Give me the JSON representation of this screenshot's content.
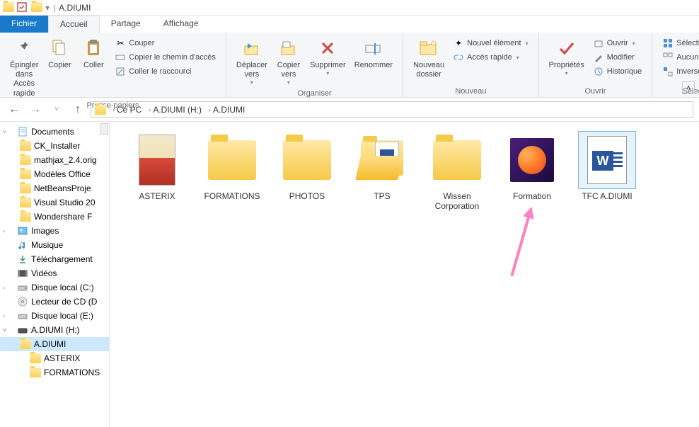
{
  "window": {
    "title": "A.DIUMI",
    "title_sep": "|"
  },
  "tabs": {
    "file": "Fichier",
    "home": "Accueil",
    "share": "Partage",
    "view": "Affichage"
  },
  "ribbon": {
    "clipboard": {
      "pin": "Épingler dans\nAccès rapide",
      "copy": "Copier",
      "paste": "Coller",
      "cut": "Couper",
      "copypath": "Copier le chemin d'accès",
      "shortcut": "Coller le raccourci",
      "label": "Presse-papiers"
    },
    "organize": {
      "moveto": "Déplacer\nvers",
      "copyto": "Copier\nvers",
      "delete": "Supprimer",
      "rename": "Renommer",
      "label": "Organiser"
    },
    "new": {
      "newfolder": "Nouveau\ndossier",
      "newitem": "Nouvel élément",
      "quickaccess": "Accès rapide",
      "label": "Nouveau"
    },
    "open": {
      "properties": "Propriétés",
      "open": "Ouvrir",
      "edit": "Modifier",
      "history": "Historique",
      "label": "Ouvrir"
    },
    "select": {
      "all": "Sélectionner tout",
      "none": "Aucun",
      "invert": "Inverser la sélection",
      "label": "Sélectionner"
    }
  },
  "breadcrumb": {
    "root": "Ce PC",
    "drive": "A.DIUMI (H:)",
    "folder": "A.DIUMI"
  },
  "tree": {
    "documents": "Documents",
    "ck": "CK_Installer",
    "mathjax": "mathjax_2.4.orig",
    "modeles": "Modèles Office",
    "netbeans": "NetBeansProje",
    "vs": "Visual Studio 20",
    "wonder": "Wondershare F",
    "images": "Images",
    "music": "Musique",
    "downloads": "Téléchargement",
    "videos": "Vidéos",
    "diskc": "Disque local (C:)",
    "cd": "Lecteur de CD (D",
    "diske": "Disque local (E:)",
    "driveh": "A.DIUMI (H:)",
    "adiumi": "A.DIUMI",
    "asterix": "ASTERIX",
    "formations": "FORMATIONS"
  },
  "items": {
    "asterix": "ASTERIX",
    "formations": "FORMATIONS",
    "photos": "PHOTOS",
    "tps": "TPS",
    "wissen": "Wissen\nCorporation",
    "formation": "Formation",
    "tfc": "TFC A.DIUMI"
  }
}
